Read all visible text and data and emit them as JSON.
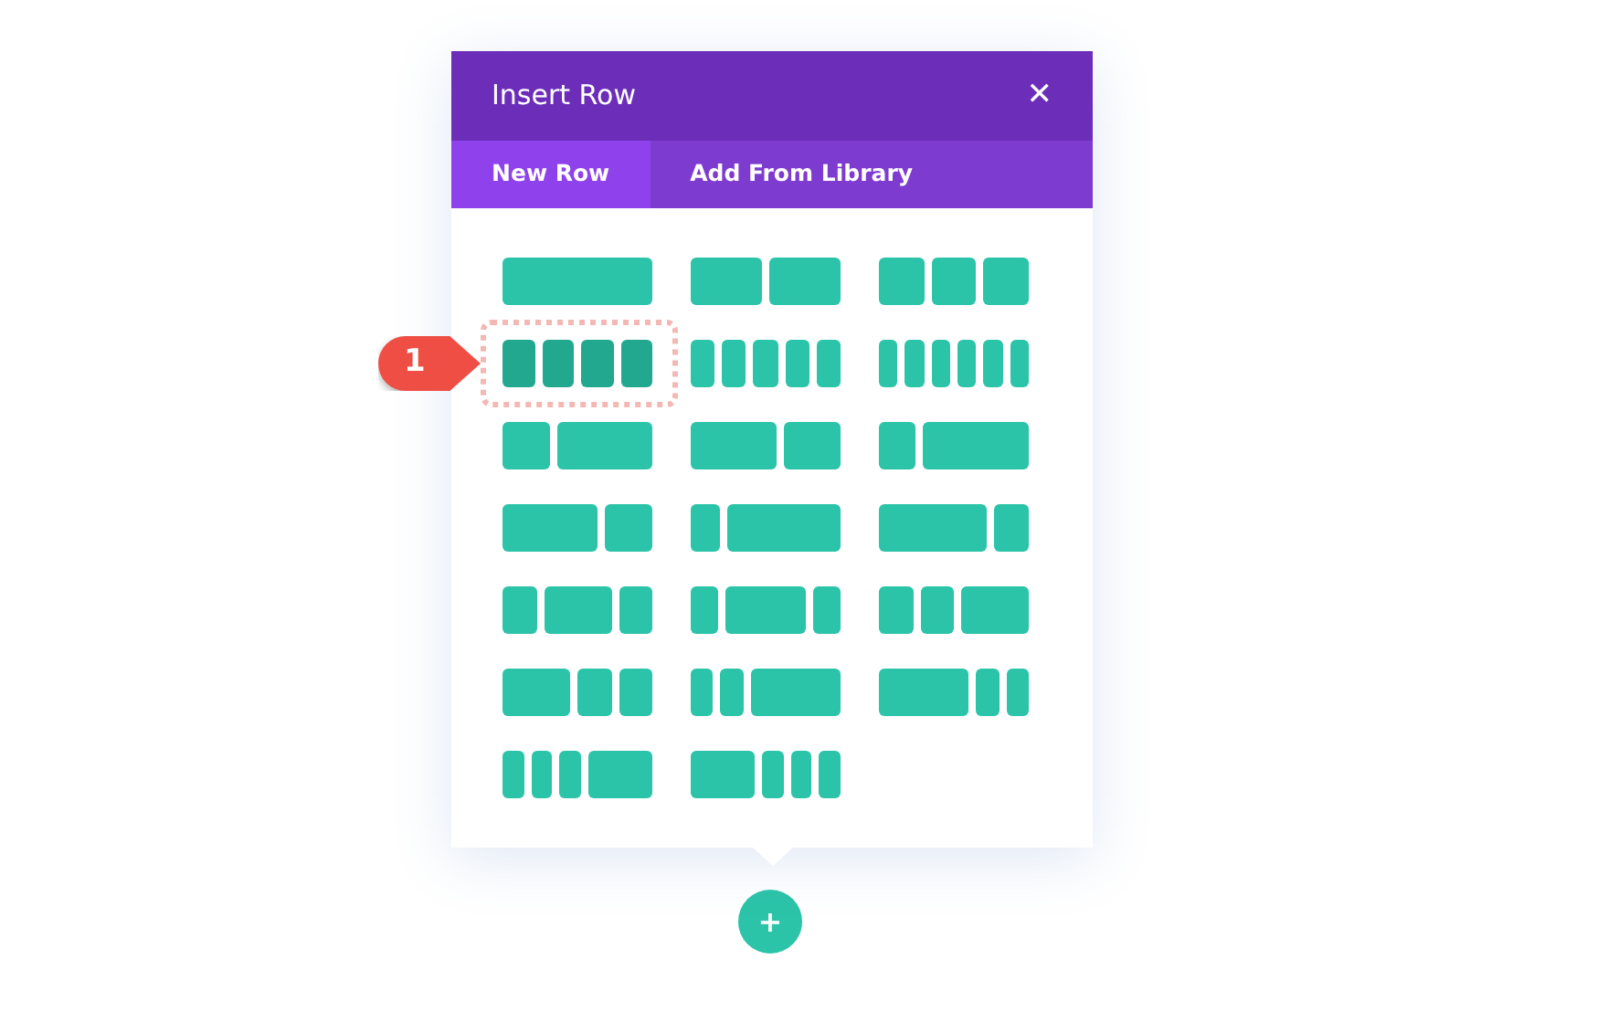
{
  "modal": {
    "title": "Insert Row",
    "close_symbol": "✕"
  },
  "tabs": [
    {
      "label": "New Row",
      "selected": true
    },
    {
      "label": "Add From Library",
      "selected": false
    }
  ],
  "layouts": [
    {
      "kind": "full",
      "selected": false
    },
    {
      "kind": "halves",
      "selected": false
    },
    {
      "kind": "thirds",
      "selected": false
    },
    {
      "kind": "quarters",
      "selected": true
    },
    {
      "kind": "fifths",
      "selected": false
    },
    {
      "kind": "sixths",
      "selected": false
    },
    {
      "kind": "third-twothirds",
      "selected": false
    },
    {
      "kind": "threefifths-twofifths",
      "selected": false
    },
    {
      "kind": "quarter-threequarters",
      "selected": false
    },
    {
      "kind": "twothirds-third",
      "selected": false
    },
    {
      "kind": "fifth-fourfifths",
      "selected": false
    },
    {
      "kind": "threequarters-quarter",
      "selected": false
    },
    {
      "kind": "quarter-half-quarter",
      "selected": false
    },
    {
      "kind": "fifth-threefifths-fifth",
      "selected": false
    },
    {
      "kind": "quarter-quarter-half",
      "selected": false
    },
    {
      "kind": "half-quarter-quarter",
      "selected": false
    },
    {
      "kind": "sixth-sixth-twothirds",
      "selected": false
    },
    {
      "kind": "twothirds-sixth-sixth",
      "selected": false
    },
    {
      "kind": "sixth-sixth-sixth-half",
      "selected": false
    },
    {
      "kind": "half-sixth-sixth-sixth",
      "selected": false
    }
  ],
  "callout": {
    "text": "1"
  },
  "add_button": {
    "symbol": "+"
  }
}
